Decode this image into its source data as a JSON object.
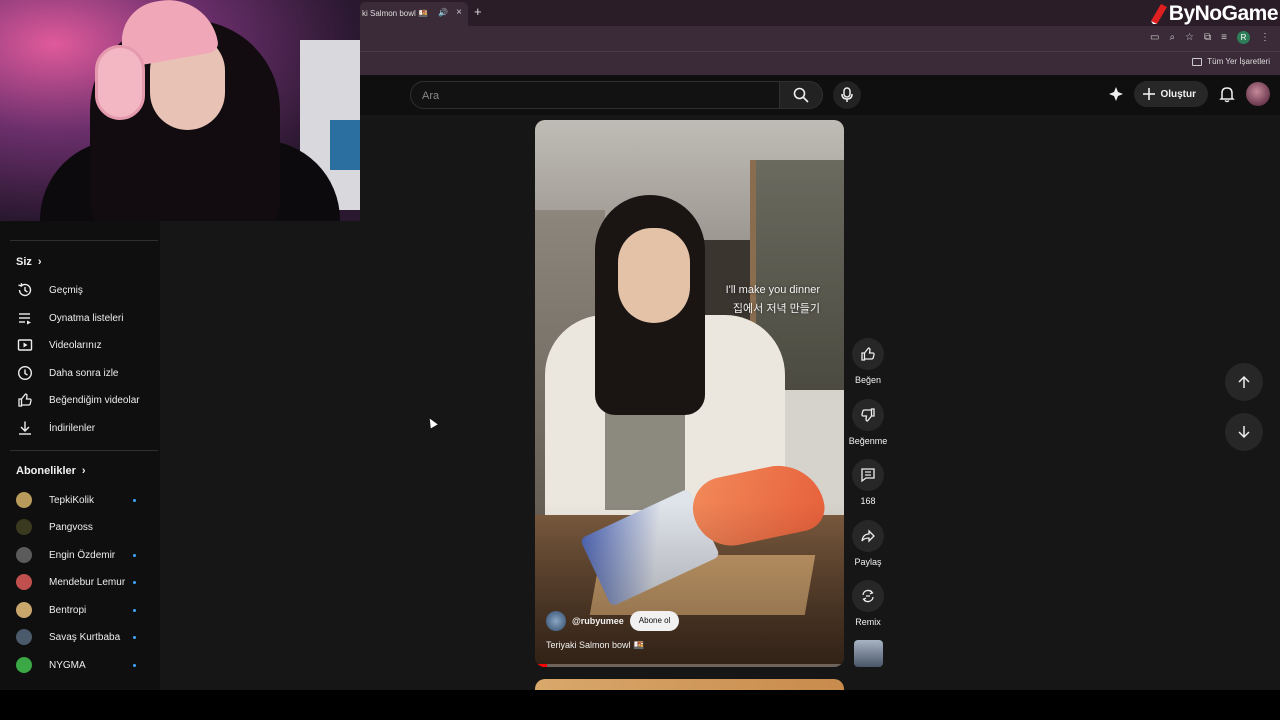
{
  "browser": {
    "tab_title": "ki Salmon bowl 🍱",
    "tab_close": "×",
    "tab_audio": "🔊",
    "new_tab": "+",
    "bookmarks_label": "Tüm Yer İşaretleri",
    "profile_initial": "R"
  },
  "brand": {
    "name": "ByNoGame"
  },
  "header": {
    "search_placeholder": "Ara",
    "create_label": "Oluştur"
  },
  "sidebar": {
    "siz_label": "Siz",
    "you_items": [
      {
        "label": "Geçmiş",
        "icon": "history-icon"
      },
      {
        "label": "Oynatma listeleri",
        "icon": "playlist-icon"
      },
      {
        "label": "Videolarınız",
        "icon": "your-videos-icon"
      },
      {
        "label": "Daha sonra izle",
        "icon": "watch-later-icon"
      },
      {
        "label": "Beğendiğim videolar",
        "icon": "liked-videos-icon"
      },
      {
        "label": "İndirilenler",
        "icon": "download-icon"
      }
    ],
    "subs_label": "Abonelikler",
    "subscriptions": [
      {
        "name": "TepkiKolik",
        "color": "#b89a5a",
        "new": true
      },
      {
        "name": "Pangvoss",
        "color": "#3a3a20",
        "new": false
      },
      {
        "name": "Engin Özdemir",
        "color": "#5b5b5b",
        "new": true
      },
      {
        "name": "Mendebur Lemur",
        "color": "#c0504d",
        "new": true
      },
      {
        "name": "Bentropi",
        "color": "#c9a66b",
        "new": true
      },
      {
        "name": "Savaş Kurtbaba",
        "color": "#4a5a6a",
        "new": true
      },
      {
        "name": "NYGMA",
        "color": "#3aa845",
        "new": true
      }
    ]
  },
  "video": {
    "caption_en": "I'll make you dinner",
    "caption_ko": "집에서 저녁 만들기",
    "channel": "@rubyumee",
    "subscribe_label": "Abone ol",
    "title": "Teriyaki Salmon bowl 🍱",
    "progress": 0.04
  },
  "actions": {
    "like": "Beğen",
    "dislike": "Beğenme",
    "comments": "168",
    "share": "Paylaş",
    "remix": "Remix"
  },
  "colors": {
    "accent_red": "#ff0000",
    "new_dot": "#3ea6ff",
    "chrome": "#3b2a37"
  }
}
